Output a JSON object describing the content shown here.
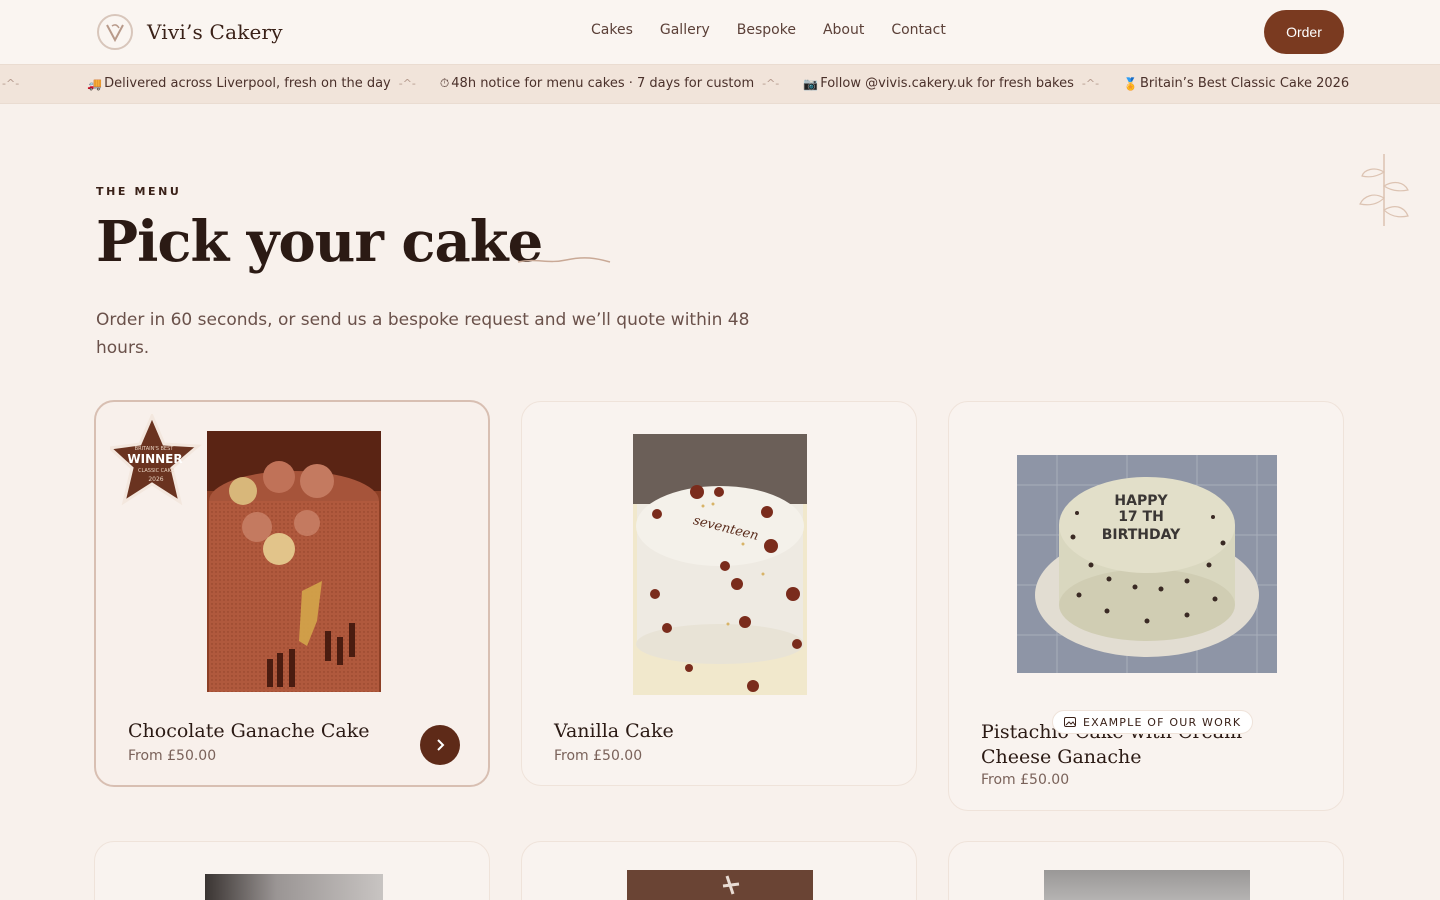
{
  "header": {
    "brand": "Vivi’s Cakery",
    "nav": [
      "Cakes",
      "Gallery",
      "Bespoke",
      "About",
      "Contact"
    ],
    "order_label": "Order"
  },
  "ticker": [
    {
      "icon": "delivery-truck-icon",
      "emoji": "🚚",
      "text": "Delivered across Liverpool, fresh on the day"
    },
    {
      "icon": "clock-icon",
      "emoji": "⏱",
      "text": "48h notice for menu cakes · 7 days for custom"
    },
    {
      "icon": "camera-icon",
      "emoji": "📷",
      "text": "Follow @vivis.cakery.uk for fresh bakes"
    },
    {
      "icon": "medal-icon",
      "emoji": "🏅",
      "text": "Britain’s Best Classic Cake 2026"
    }
  ],
  "hero": {
    "eyebrow": "THE MENU",
    "title": "Pick your cake",
    "subtitle": "Order in 60 seconds, or send us a bespoke request and we’ll quote within 48 hours."
  },
  "cards": [
    {
      "name": "Chocolate Ganache Cake",
      "price": "From £50.00",
      "badge_lines": [
        "BRITAIN'S BEST",
        "WINNER",
        "CLASSIC CAKE",
        "2026"
      ]
    },
    {
      "name": "Vanilla Cake",
      "price": "From £50.00",
      "cake_text": "seventeen"
    },
    {
      "name": "Pistachio Cake with Cream Cheese Ganache",
      "name_line1": "Pistachio Cake with Cream",
      "name_line2": "Cheese Ganache",
      "price": "From £50.00",
      "cake_text": [
        "HAPPY",
        "17 TH",
        "BIRTHDAY"
      ],
      "example_label": "EXAMPLE OF OUR WORK"
    }
  ],
  "colors": {
    "accent": "#7a3a20",
    "background": "#f8f1ec",
    "text": "#2b1a14"
  }
}
